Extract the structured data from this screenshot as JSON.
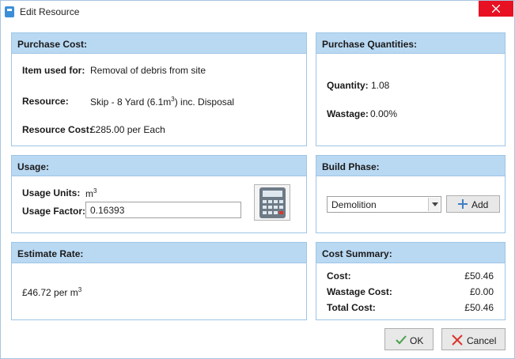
{
  "window": {
    "title": "Edit Resource"
  },
  "purchase_cost": {
    "header": "Purchase Cost:",
    "item_label": "Item used for:",
    "item_value": "Removal of debris from site",
    "resource_label": "Resource:",
    "resource_prefix": "Skip - 8 Yard (6.1m",
    "resource_sup": "3",
    "resource_suffix": ") inc. Disposal",
    "cost_label": "Resource Cost:",
    "cost_value": "£285.00 per Each"
  },
  "purchase_quantities": {
    "header": "Purchase Quantities:",
    "quantity_label": "Quantity:",
    "quantity_value": "1.08",
    "wastage_label": "Wastage:",
    "wastage_value": "0.00%"
  },
  "usage": {
    "header": "Usage:",
    "units_label": "Usage Units:",
    "units_value": "m",
    "units_sup": "3",
    "factor_label": "Usage Factor:",
    "factor_value": "0.16393"
  },
  "build_phase": {
    "header": "Build Phase:",
    "selected": "Demolition",
    "add_label": "Add"
  },
  "estimate_rate": {
    "header": "Estimate Rate:",
    "value_prefix": "£46.72 per m",
    "value_sup": "3"
  },
  "cost_summary": {
    "header": "Cost Summary:",
    "cost_label": "Cost:",
    "cost_value": "£50.46",
    "wastage_label": "Wastage Cost:",
    "wastage_value": "£0.00",
    "total_label": "Total Cost:",
    "total_value": "£50.46"
  },
  "footer": {
    "ok_label": "OK",
    "cancel_label": "Cancel"
  },
  "colors": {
    "panel_header": "#b9d8f2",
    "panel_border": "#9fc5e6",
    "close_button": "#e81123",
    "ok_check": "#4aa04a",
    "cancel_x": "#d9352b",
    "add_plus": "#3f7fc4"
  }
}
